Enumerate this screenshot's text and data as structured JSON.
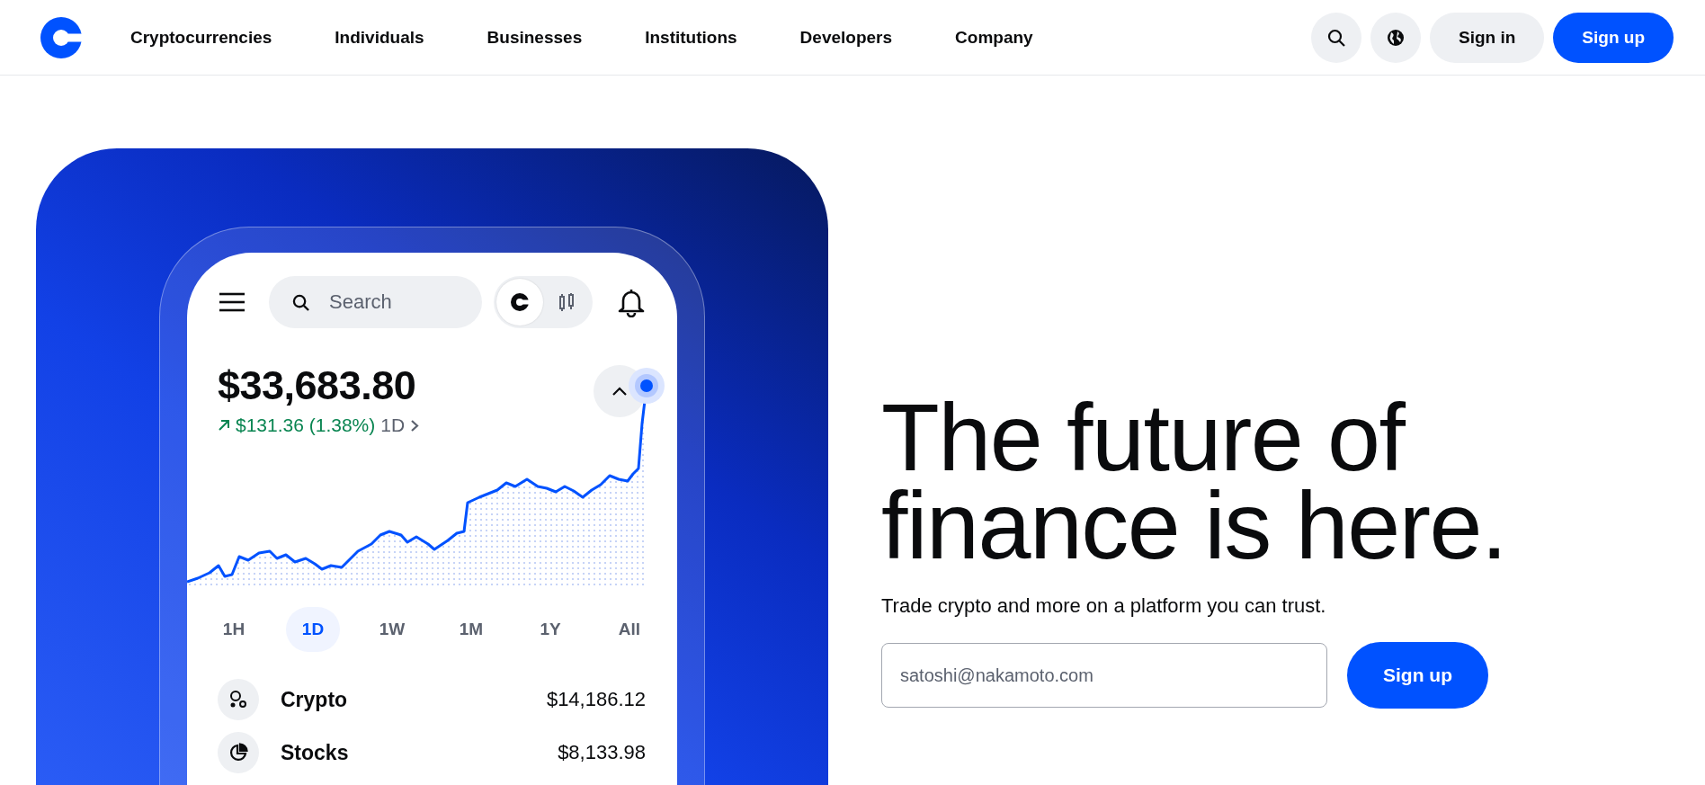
{
  "nav": {
    "links": [
      {
        "label": "Cryptocurrencies"
      },
      {
        "label": "Individuals"
      },
      {
        "label": "Businesses"
      },
      {
        "label": "Institutions"
      },
      {
        "label": "Developers"
      },
      {
        "label": "Company"
      }
    ],
    "sign_in": "Sign in",
    "sign_up": "Sign up"
  },
  "phone": {
    "search_placeholder": "Search",
    "view_toggle": [
      {
        "kind": "coin",
        "selected": true
      },
      {
        "kind": "candles",
        "selected": false
      }
    ],
    "balance": "$33,683.80",
    "change": "$131.36 (1.38%)",
    "period": "1D",
    "ranges": [
      {
        "label": "1H",
        "selected": false
      },
      {
        "label": "1D",
        "selected": true
      },
      {
        "label": "1W",
        "selected": false
      },
      {
        "label": "1M",
        "selected": false
      },
      {
        "label": "1Y",
        "selected": false
      },
      {
        "label": "All",
        "selected": false
      }
    ],
    "assets": [
      {
        "kind": "crypto",
        "name": "Crypto",
        "value": "$14,186.12"
      },
      {
        "kind": "stocks",
        "name": "Stocks",
        "value": "$8,133.98"
      }
    ]
  },
  "hero": {
    "headline": "The future of finance is here.",
    "subtitle": "Trade crypto and more on a platform you can trust.",
    "email_placeholder": "satoshi@nakamoto.com",
    "button": "Sign up"
  }
}
